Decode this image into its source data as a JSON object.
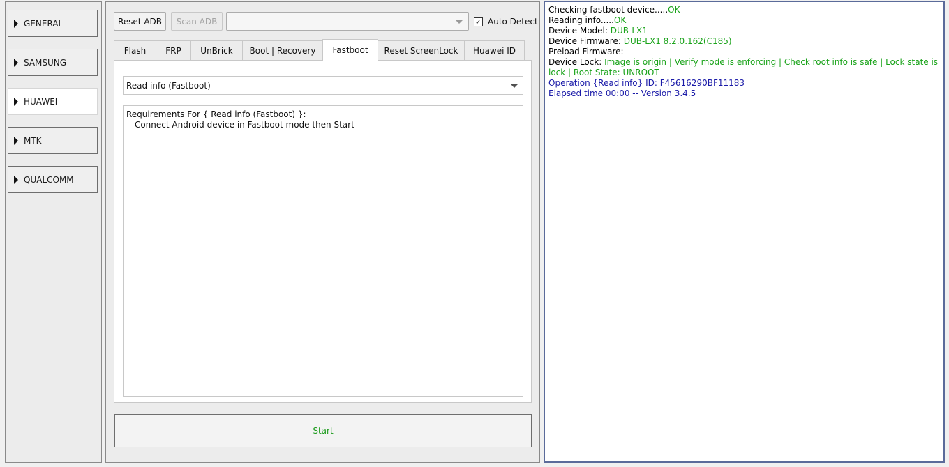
{
  "nav": {
    "items": [
      {
        "label": "GENERAL",
        "active": false
      },
      {
        "label": "SAMSUNG",
        "active": false
      },
      {
        "label": "HUAWEI",
        "active": true
      },
      {
        "label": "MTK",
        "active": false
      },
      {
        "label": "QUALCOMM",
        "active": false
      }
    ]
  },
  "toolbar": {
    "reset_adb_label": "Reset ADB",
    "scan_adb_label": "Scan ADB",
    "device_combo_value": "",
    "auto_detect_label": "Auto Detect",
    "auto_detect_checked": true
  },
  "tabs": [
    {
      "label": "Flash",
      "active": false
    },
    {
      "label": "FRP",
      "active": false
    },
    {
      "label": "UnBrick",
      "active": false
    },
    {
      "label": "Boot | Recovery",
      "active": false
    },
    {
      "label": "Fastboot",
      "active": true
    },
    {
      "label": "Reset ScreenLock",
      "active": false
    },
    {
      "label": "Huawei ID",
      "active": false
    }
  ],
  "fastboot": {
    "operation_value": "Read info (Fastboot)",
    "requirements_line1": "Requirements For { Read info (Fastboot) }:",
    "requirements_line2": " - Connect Android device in Fastboot mode then Start"
  },
  "start_label": "Start",
  "log": {
    "l1_label": "Checking fastboot device.....",
    "l1_value": "OK",
    "l2_label": "Reading info.....",
    "l2_value": "OK",
    "l3_label": "Device Model: ",
    "l3_value": "DUB-LX1",
    "l4_label": "Device Firmware: ",
    "l4_value": "DUB-LX1 8.2.0.162(C185)",
    "l5_label": "Preload Firmware:",
    "l6_label": "Device Lock: ",
    "l6_value": "Image is origin | Verify mode is enforcing | Check root info is safe | Lock state is lock | Root State: UNROOT",
    "l7_text": "Operation {Read info} ID: F45616290BF11183",
    "l8_text": "Elapsed time 00:00 -- Version 3.4.5"
  },
  "colors": {
    "ok_green": "#1aa31a",
    "info_blue": "#1a1aa8",
    "log_border": "#5b6b9a"
  }
}
